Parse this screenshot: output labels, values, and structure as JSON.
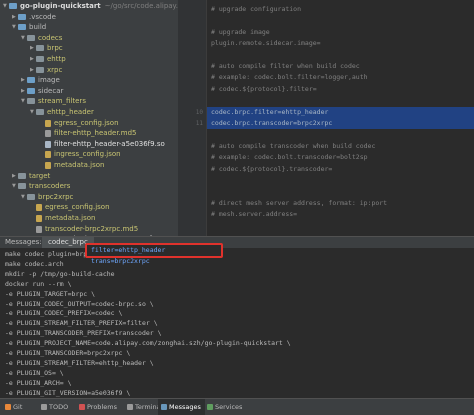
{
  "tree": {
    "items": [
      {
        "label": "go-plugin-quickstart",
        "detail": "~/go/src/code.alipay.com/",
        "depth": 0,
        "icon": "folder-icon",
        "style": "strong",
        "open": true
      },
      {
        "label": ".vscode",
        "depth": 1,
        "icon": "folder-icon",
        "style": "normal",
        "open": false
      },
      {
        "label": "build",
        "depth": 1,
        "icon": "folder-icon",
        "style": "normal",
        "open": true
      },
      {
        "label": "codecs",
        "depth": 2,
        "icon": "folder-icon",
        "style": "yellow",
        "open": true
      },
      {
        "label": "brpc",
        "depth": 3,
        "icon": "folder-icon",
        "style": "yellow",
        "open": false
      },
      {
        "label": "ehttp",
        "depth": 3,
        "icon": "folder-icon",
        "style": "yellow",
        "open": false
      },
      {
        "label": "xrpc",
        "depth": 3,
        "icon": "folder-icon",
        "style": "yellow",
        "open": false
      },
      {
        "label": "image",
        "depth": 2,
        "icon": "folder-icon",
        "style": "normal",
        "open": false
      },
      {
        "label": "sidecar",
        "depth": 2,
        "icon": "folder-icon",
        "style": "normal",
        "open": false
      },
      {
        "label": "stream_filters",
        "depth": 2,
        "icon": "folder-icon",
        "style": "yellow",
        "open": true
      },
      {
        "label": "ehttp_header",
        "depth": 3,
        "icon": "folder-icon",
        "style": "yellow",
        "open": true
      },
      {
        "label": "egress_config.json",
        "depth": 4,
        "icon": "json-file-icon",
        "style": "yellow",
        "open": null
      },
      {
        "label": "filter-ehttp_header.md5",
        "depth": 4,
        "icon": "md5-file-icon",
        "style": "yellow",
        "open": null
      },
      {
        "label": "filter-ehttp_header-a5e036f9.so",
        "depth": 4,
        "icon": "so-file-icon",
        "style": "white",
        "open": null
      },
      {
        "label": "ingress_config.json",
        "depth": 4,
        "icon": "json-file-icon",
        "style": "yellow",
        "open": null
      },
      {
        "label": "metadata.json",
        "depth": 4,
        "icon": "json-file-icon",
        "style": "yellow",
        "open": null
      },
      {
        "label": "target",
        "depth": 1,
        "icon": "folder-icon",
        "style": "yellow",
        "open": false
      },
      {
        "label": "transcoders",
        "depth": 1,
        "icon": "folder-icon",
        "style": "yellow",
        "open": true
      },
      {
        "label": "brpc2xrpc",
        "depth": 2,
        "icon": "folder-icon",
        "style": "yellow",
        "open": true
      },
      {
        "label": "egress_config.json",
        "depth": 3,
        "icon": "json-file-icon",
        "style": "yellow",
        "open": null
      },
      {
        "label": "metadata.json",
        "depth": 3,
        "icon": "json-file-icon",
        "style": "yellow",
        "open": null
      },
      {
        "label": "transcoder-brpc2xrpc.md5",
        "depth": 3,
        "icon": "md5-file-icon",
        "style": "yellow",
        "open": null
      },
      {
        "label": "transcoder-brpc2xrpc-a5e036f9.so",
        "depth": 3,
        "icon": "so-file-icon",
        "style": "white",
        "open": null
      }
    ]
  },
  "editor": {
    "lines": [
      {
        "num": "",
        "text": "# upgrade configuration",
        "hl": false
      },
      {
        "num": "",
        "text": "",
        "hl": false
      },
      {
        "num": "",
        "text": "# upgrade image",
        "hl": false
      },
      {
        "num": "",
        "text": "plugin.remote.sidecar.image=",
        "hl": false
      },
      {
        "num": "",
        "text": "",
        "hl": false
      },
      {
        "num": "",
        "text": "# auto compile filter when build codec",
        "hl": false
      },
      {
        "num": "",
        "text": "# example: codec.bolt.filter=logger,auth",
        "hl": false
      },
      {
        "num": "",
        "text": "# codec.${protocol}.filter=",
        "hl": false
      },
      {
        "num": "",
        "text": "",
        "hl": false
      },
      {
        "num": "10",
        "text": "codec.brpc.filter=ehttp_header",
        "hl": true
      },
      {
        "num": "11",
        "text": "codec.brpc.transcoder=brpc2xrpc",
        "hl": true
      },
      {
        "num": "",
        "text": "",
        "hl": false
      },
      {
        "num": "",
        "text": "# auto compile transcoder when build codec",
        "hl": false
      },
      {
        "num": "",
        "text": "# example: codec.bolt.transcoder=bolt2sp",
        "hl": false
      },
      {
        "num": "",
        "text": "# codec.${protocol}.transcoder=",
        "hl": false
      },
      {
        "num": "",
        "text": "",
        "hl": false
      },
      {
        "num": "",
        "text": "",
        "hl": false
      },
      {
        "num": "",
        "text": "# direct mesh server address, format: ip:port",
        "hl": false
      },
      {
        "num": "",
        "text": "# mesh.server.address=",
        "hl": false
      }
    ]
  },
  "messages": {
    "title": "Messages:",
    "tab": "codec_brpc",
    "callout": "filter=ehttp_header trans=brpc2xrpc",
    "lines": [
      "make codec plugin=brpc",
      "make codec.arch",
      "mkdir -p /tmp/go-build-cache",
      "docker run --rm  \\",
      "    -e PLUGIN_TARGET=brpc \\",
      "    -e PLUGIN_CODEC_OUTPUT=codec-brpc.so \\",
      "    -e PLUGIN_CODEC_PREFIX=codec \\",
      "    -e PLUGIN_STREAM_FILTER_PREFIX=filter \\",
      "    -e PLUGIN_TRANSCODER_PREFIX=transcoder \\",
      "    -e PLUGIN_PROJECT_NAME=code.alipay.com/zonghai.szh/go-plugin-quickstart \\",
      "    -e PLUGIN_TRANSCODER=brpc2xrpc \\",
      "    -e PLUGIN_STREAM_FILTER=ehttp_header \\",
      "    -e PLUGIN_OS= \\",
      "    -e PLUGIN_ARCH= \\",
      "    -e PLUGIN_GIT_VERSION=a5e036f9 \\"
    ]
  },
  "toolstrip": {
    "items": [
      {
        "label": "Git",
        "icon": "git-icon",
        "active": false
      },
      {
        "label": "TODO",
        "icon": "todo-icon",
        "active": false
      },
      {
        "label": "Problems",
        "icon": "problems-icon",
        "active": false
      },
      {
        "label": "Terminal",
        "icon": "terminal-icon",
        "active": false
      },
      {
        "label": "Messages",
        "icon": "messages-icon",
        "active": true
      },
      {
        "label": "Services",
        "icon": "services-icon",
        "active": false
      }
    ]
  }
}
